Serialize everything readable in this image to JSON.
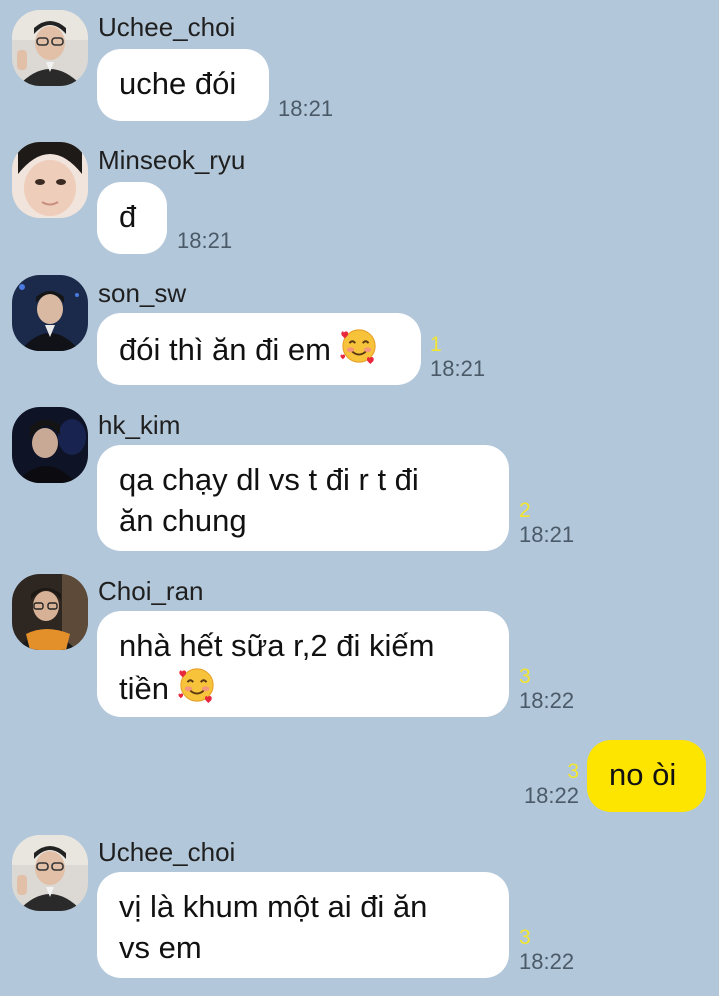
{
  "messages": [
    {
      "sender": "Uchee_choi",
      "text": "uche đói",
      "time": "18:21",
      "unread": ""
    },
    {
      "sender": "Minseok_ryu",
      "text": "đ",
      "time": "18:21",
      "unread": ""
    },
    {
      "sender": "son_sw",
      "text": "đói thì ăn đi em",
      "emoji": "smiling-face-with-hearts",
      "time": "18:21",
      "unread": "1"
    },
    {
      "sender": "hk_kim",
      "line1": "qa chạy dl vs t đi r t đi",
      "line2": "ăn chung",
      "time": "18:21",
      "unread": "2"
    },
    {
      "sender": "Choi_ran",
      "line1": "nhà hết sữa r,2 đi kiếm",
      "line2": "tiền",
      "emoji": "smiling-face-with-hearts",
      "time": "18:22",
      "unread": "3"
    },
    {
      "sender": "me",
      "text": "no òi",
      "time": "18:22",
      "unread": "3"
    },
    {
      "sender": "Uchee_choi",
      "line1": "vị là khum một ai đi ăn",
      "line2": "vs em",
      "time": "18:22",
      "unread": "3"
    }
  ],
  "colors": {
    "background": "#b2c7d9",
    "incoming_bubble": "#ffffff",
    "outgoing_bubble": "#fee500",
    "unread": "#f2e531"
  }
}
